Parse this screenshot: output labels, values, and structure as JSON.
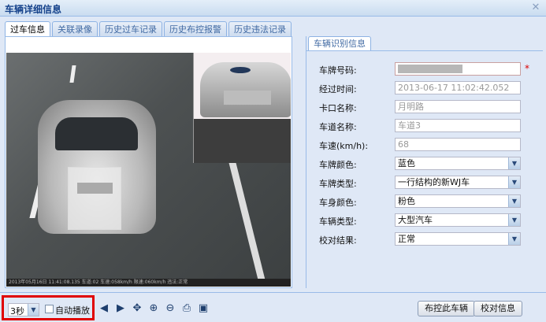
{
  "window": {
    "title": "车辆详细信息"
  },
  "tabs": [
    {
      "label": "过车信息",
      "active": true
    },
    {
      "label": "关联录像"
    },
    {
      "label": "历史过车记录"
    },
    {
      "label": "历史布控报警"
    },
    {
      "label": "历史违法记录"
    }
  ],
  "image": {
    "caption": "2013年05月16日 11:41:08.135 车道:02    车速:058km/h  限速:060km/h  违法:正常"
  },
  "recognition": {
    "tab_label": "车辆识别信息",
    "fields": [
      {
        "label": "车牌号码:",
        "value": "",
        "type": "text",
        "required": true
      },
      {
        "label": "经过时间:",
        "value": "2013-06-17 11:02:42.052",
        "type": "text"
      },
      {
        "label": "卡口名称:",
        "value": "月明路",
        "type": "text"
      },
      {
        "label": "车道名称:",
        "value": "车道3",
        "type": "text"
      },
      {
        "label": "车速(km/h):",
        "value": "68",
        "type": "text"
      },
      {
        "label": "车牌颜色:",
        "value": "蓝色",
        "type": "select"
      },
      {
        "label": "车牌类型:",
        "value": "一行结构的新WJ车",
        "type": "select"
      },
      {
        "label": "车身颜色:",
        "value": "粉色",
        "type": "select"
      },
      {
        "label": "车辆类型:",
        "value": "大型汽车",
        "type": "select"
      },
      {
        "label": "校对结果:",
        "value": "正常",
        "type": "select"
      }
    ],
    "required_mark": "*"
  },
  "toolbar": {
    "interval": "3秒",
    "autoplay_label": "自动播放",
    "icons": [
      "arrow-left-icon",
      "arrow-right-icon",
      "move-icon",
      "zoom-in-icon",
      "zoom-out-icon",
      "print-icon",
      "save-icon"
    ],
    "monitor_button": "布控此车辆",
    "verify_button": "校对信息"
  },
  "colors": {
    "accent": "#15428b",
    "panel": "#dfe8f6",
    "border": "#99bbe8",
    "highlight": "#e00000"
  }
}
